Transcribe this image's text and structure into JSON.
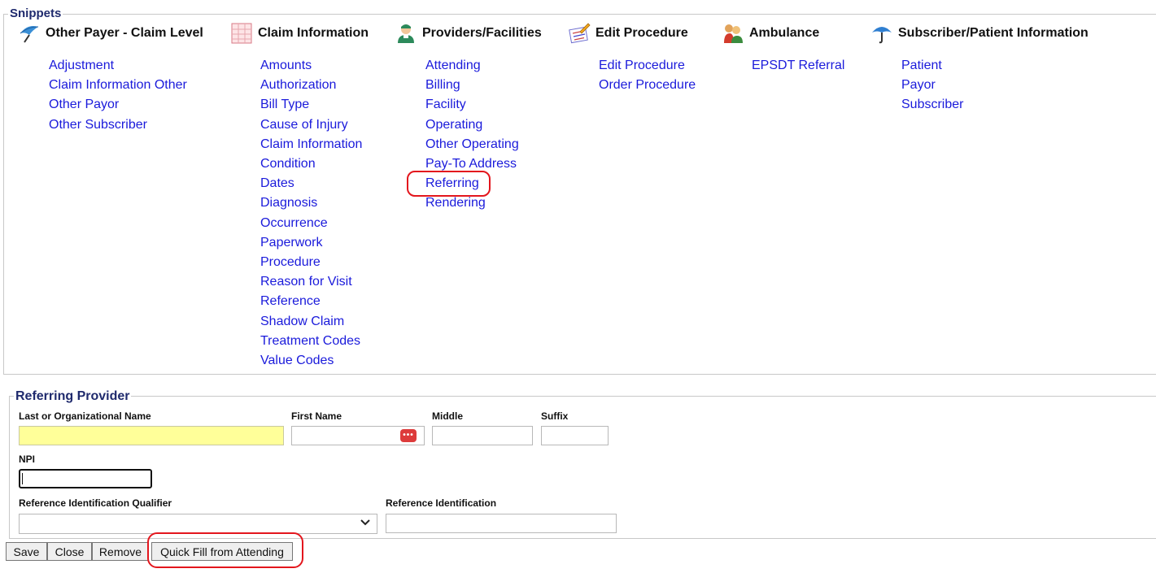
{
  "snippets": {
    "legend": "Snippets",
    "columns": [
      {
        "title": "Other Payer - Claim Level",
        "icon": "umbrella-icon",
        "links": [
          "Adjustment",
          "Claim Information Other",
          "Other Payor",
          "Other Subscriber"
        ]
      },
      {
        "title": "Claim Information",
        "icon": "form-icon",
        "links": [
          "Amounts",
          "Authorization",
          "Bill Type",
          "Cause of Injury",
          "Claim Information",
          "Condition",
          "Dates",
          "Diagnosis",
          "Occurrence",
          "Paperwork",
          "Procedure",
          "Reason for Visit",
          "Reference",
          "Shadow Claim",
          "Treatment Codes",
          "Value Codes"
        ]
      },
      {
        "title": "Providers/Facilities",
        "icon": "doctor-icon",
        "links": [
          "Attending",
          "Billing",
          "Facility",
          "Operating",
          "Other Operating",
          "Pay-To Address",
          "Referring",
          "Rendering"
        ]
      },
      {
        "title": "Edit Procedure",
        "icon": "edit-document-icon",
        "links": [
          "Edit Procedure",
          "Order Procedure"
        ]
      },
      {
        "title": "Ambulance",
        "icon": "people-icon",
        "links": [
          "EPSDT Referral"
        ]
      },
      {
        "title": "Subscriber/Patient Information",
        "icon": "umbrella-blue-icon",
        "links": [
          "Patient",
          "Payor",
          "Subscriber"
        ]
      }
    ]
  },
  "referring_provider": {
    "legend": "Referring Provider",
    "last_name_label": "Last or Organizational Name",
    "last_name_value": "",
    "first_name_label": "First Name",
    "first_name_value": "",
    "middle_label": "Middle",
    "middle_value": "",
    "suffix_label": "Suffix",
    "suffix_value": "",
    "npi_label": "NPI",
    "npi_value": "",
    "ref_qualifier_label": "Reference Identification Qualifier",
    "ref_qualifier_value": "",
    "ref_id_label": "Reference Identification",
    "ref_id_value": ""
  },
  "buttons": {
    "save": "Save",
    "close": "Close",
    "remove": "Remove",
    "quick_fill": "Quick Fill from Attending"
  },
  "colors": {
    "link": "#1a1adb",
    "legend": "#1f2a6d",
    "highlight": "#e3161d",
    "required_field": "#ffff99"
  }
}
